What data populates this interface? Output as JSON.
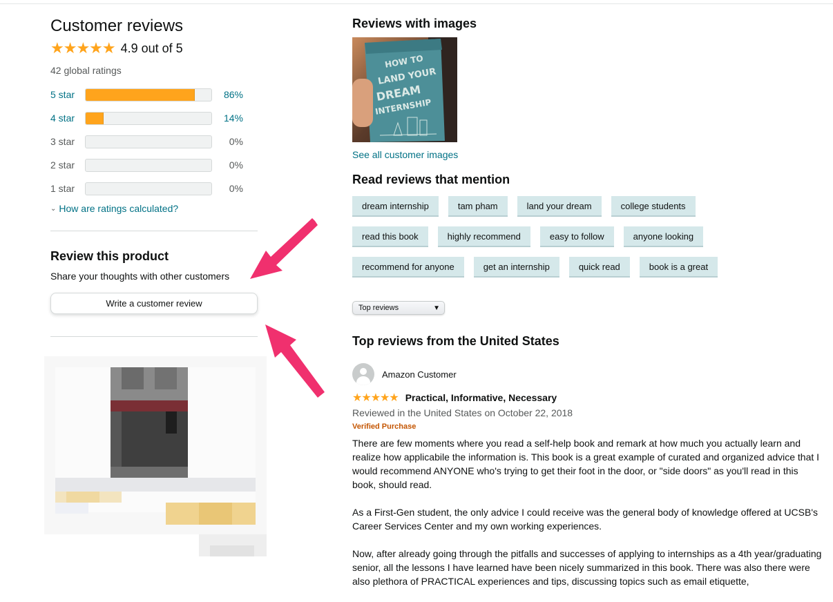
{
  "summary": {
    "title": "Customer reviews",
    "stars": "★★★★★",
    "average": "4.9 out of 5",
    "global_ratings": "42 global ratings",
    "histogram": [
      {
        "label": "5 star",
        "percent_text": "86%",
        "percent": 86
      },
      {
        "label": "4 star",
        "percent_text": "14%",
        "percent": 14
      },
      {
        "label": "3 star",
        "percent_text": "0%",
        "percent": 0
      },
      {
        "label": "2 star",
        "percent_text": "0%",
        "percent": 0
      },
      {
        "label": "1 star",
        "percent_text": "0%",
        "percent": 0
      }
    ],
    "how_calculated": "How are ratings calculated?"
  },
  "review_product": {
    "title": "Review this product",
    "subtitle": "Share your thoughts with other customers",
    "button": "Write a customer review"
  },
  "images": {
    "title": "Reviews with images",
    "book_title": "HOW TO LAND YOUR DREAM INTERNSHIP",
    "see_all": "See all customer images"
  },
  "mentions": {
    "title": "Read reviews that mention",
    "chips": [
      "dream internship",
      "tam pham",
      "land your dream",
      "college students",
      "read this book",
      "highly recommend",
      "easy to follow",
      "anyone looking",
      "recommend for anyone",
      "get an internship",
      "quick read",
      "book is a great"
    ]
  },
  "sort": {
    "selected": "Top reviews"
  },
  "top_reviews": {
    "title": "Top reviews from the United States",
    "review": {
      "name": "Amazon Customer",
      "stars": "★★★★★",
      "headline": "Practical, Informative, Necessary",
      "date": "Reviewed in the United States on October 22, 2018",
      "verified": "Verified Purchase",
      "paragraphs": [
        "There are few moments where you read a self-help book and remark at how much you actually learn and realize how applicabile the information is. This book is a great example of curated and organized advice that I would recommend ANYONE who's trying to get their foot in the door, or \"side doors\" as you'll read in this book, should read.",
        "As a First-Gen student, the only advice I could receive was the general body of knowledge offered at UCSB's Career Services Center and my own working experiences.",
        "Now, after already going through the pitfalls and successes of applying to internships as a 4th year/graduating senior, all the lessons I have learned have been nicely summarized in this book. There was also there were also plethora of PRACTICAL experiences and tips, discussing topics such as email etiquette,"
      ]
    }
  },
  "colors": {
    "star": "#ffa41c",
    "link": "#007185",
    "verified": "#c45500",
    "chip_bg": "#d5e8ea",
    "arrow": "#f0306e"
  }
}
